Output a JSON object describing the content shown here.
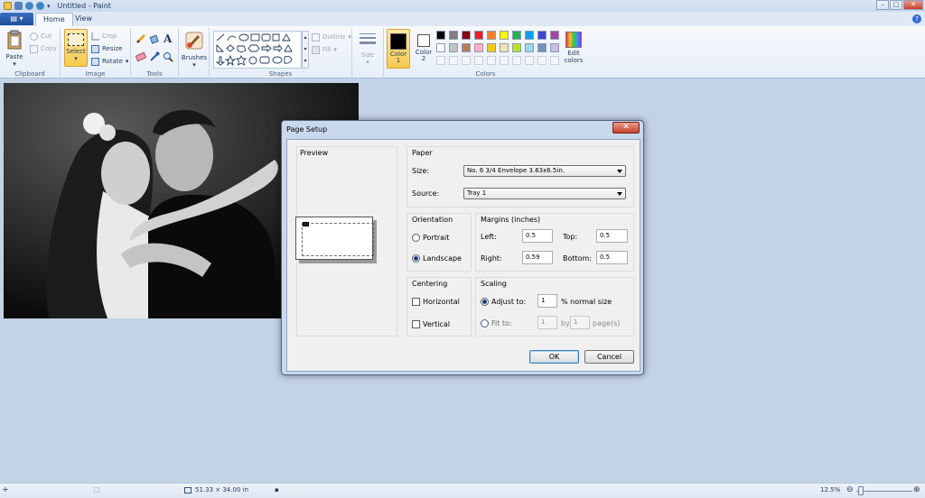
{
  "window": {
    "title": "Untitled - Paint",
    "minimize": "–",
    "maximize": "□",
    "close": "✕"
  },
  "tabs": {
    "app_menu": "▤ ▾",
    "home": "Home",
    "view": "View",
    "help": "?"
  },
  "ribbon": {
    "clipboard": {
      "label": "Clipboard",
      "paste": "Paste",
      "cut": "Cut",
      "copy": "Copy"
    },
    "image": {
      "label": "Image",
      "select": "Select",
      "crop": "Crop",
      "resize": "Resize",
      "rotate": "Rotate"
    },
    "tools": {
      "label": "Tools"
    },
    "brushes": {
      "label": "Brushes"
    },
    "shapes": {
      "label": "Shapes",
      "outline": "Outline",
      "fill": "Fill"
    },
    "size": {
      "label": "Size"
    },
    "colors": {
      "label": "Colors",
      "color1": "Color 1",
      "color2": "Color 2",
      "edit_colors": "Edit colors",
      "color1_value": "#000000",
      "color2_value": "#ffffff",
      "palette_row1": [
        "#000000",
        "#7f7f7f",
        "#880015",
        "#ed1c24",
        "#ff7f27",
        "#fff200",
        "#22b14c",
        "#00a2e8",
        "#3f48cc",
        "#a349a4"
      ],
      "palette_row2": [
        "#ffffff",
        "#c3c3c3",
        "#b97a57",
        "#ffaec9",
        "#ffc90e",
        "#efe4b0",
        "#b5e61d",
        "#99d9ea",
        "#7092be",
        "#c8bfe7"
      ]
    }
  },
  "dialog": {
    "title": "Page Setup",
    "close": "✕",
    "preview_label": "Preview",
    "paper": {
      "label": "Paper",
      "size_label": "Size:",
      "size_value": "No. 6 3/4 Envelope 3.63x6.5in.",
      "source_label": "Source:",
      "source_value": "Tray 1"
    },
    "orientation": {
      "label": "Orientation",
      "portrait": "Portrait",
      "landscape": "Landscape",
      "selected": "landscape"
    },
    "margins": {
      "label": "Margins (inches)",
      "left_label": "Left:",
      "left": "0.5",
      "top_label": "Top:",
      "top": "0.5",
      "right_label": "Right:",
      "right": "0.59",
      "bottom_label": "Bottom:",
      "bottom": "0.5"
    },
    "centering": {
      "label": "Centering",
      "horizontal": "Horizontal",
      "vertical": "Vertical"
    },
    "scaling": {
      "label": "Scaling",
      "adjust_to": "Adjust to:",
      "adjust_value": "1",
      "adjust_suffix": "% normal size",
      "fit_to": "Fit to:",
      "fit_w": "1",
      "by": "by",
      "fit_h": "1",
      "pages": "page(s)"
    },
    "ok": "OK",
    "cancel": "Cancel"
  },
  "status": {
    "dimensions": "51.33 × 34.00 in",
    "zoom": "12.5%",
    "zoom_out": "⊖",
    "zoom_in": "⊕"
  }
}
